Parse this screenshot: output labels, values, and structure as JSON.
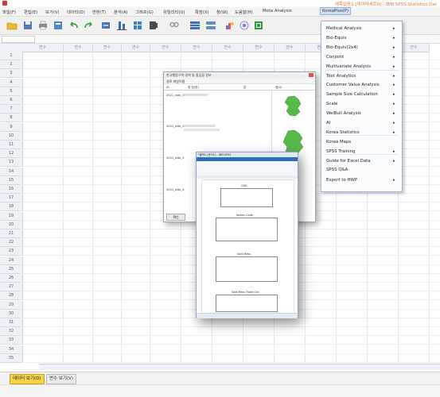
{
  "window": {
    "title": "제목없음1 [데이터세트0] - IBM SPSS Statistics Dat"
  },
  "menubar": {
    "items": [
      "파일(F)",
      "편집(E)",
      "보기(V)",
      "데이터(D)",
      "변환(T)",
      "분석(A)",
      "그래프(G)",
      "유틸리티(U)",
      "확장(X)",
      "창(W)",
      "도움말(H)",
      "Meta Analysis",
      "KoreaPlus(P)"
    ]
  },
  "grid": {
    "column_header": "변수",
    "rows": [
      "1",
      "2",
      "3",
      "4",
      "5",
      "6",
      "7",
      "8",
      "9",
      "10",
      "11",
      "12",
      "13",
      "14",
      "15",
      "16",
      "17",
      "18",
      "19",
      "20",
      "21",
      "22",
      "23",
      "24",
      "25",
      "26",
      "27",
      "28",
      "29",
      "30",
      "31",
      "32",
      "33",
      "34",
      "35"
    ]
  },
  "dropdown": {
    "items": [
      {
        "label": "Medical Analysis",
        "submenu": true
      },
      {
        "label": "Bio-Equiv",
        "submenu": true
      },
      {
        "label": "Bio-Equiv(2x4)",
        "submenu": true
      },
      {
        "label": "Conjoint",
        "submenu": true
      },
      {
        "label": "Multivariate Analysis",
        "submenu": true
      },
      {
        "label": "Text Analytics",
        "submenu": true
      },
      {
        "label": "Customer Value Analysis",
        "submenu": true
      },
      {
        "label": "Sample Size Calculation",
        "submenu": true
      },
      {
        "label": "Scale",
        "submenu": true
      },
      {
        "label": "WeiBull Analysis",
        "submenu": true
      },
      {
        "label": "AI",
        "submenu": true
      },
      {
        "label": "Korea Statistics",
        "submenu": true
      },
      {
        "label": "Korea Maps",
        "submenu": false
      },
      {
        "label": "SPSS Training",
        "submenu": true
      },
      {
        "label": "Guide for Excel Data",
        "submenu": true
      },
      {
        "label": "SPSS Q&A",
        "submenu": false
      },
      {
        "label": "Export to HWP",
        "submenu": true
      }
    ]
  },
  "dialog": {
    "title": "한국행정구역 경계 및 중심점 정보",
    "subtitle": "경로  파일이름",
    "headers": [
      "ID",
      "명 칭(한)",
      "값",
      "맵(A)"
    ],
    "rows": [
      "2021_sido_1",
      "2021_sido_2",
      "2021_sido_3",
      "2021_sido_4"
    ],
    "button": "확인"
  },
  "viewer": {
    "title": "*출력1 [문서1] - IBM SPSS",
    "table_titles": [
      "GSD",
      "Nation Code",
      "Sold Mass",
      "Sold Mass Trade Out"
    ]
  },
  "tabs": {
    "data_view": "데이터 보기(D)",
    "variable_view": "변수 보기(V)"
  },
  "colors": {
    "accent_menu": "#cfe0f7",
    "tab_active": "#f7d54a",
    "map_green": "#58b94a",
    "title_text": "#e07b3a"
  }
}
